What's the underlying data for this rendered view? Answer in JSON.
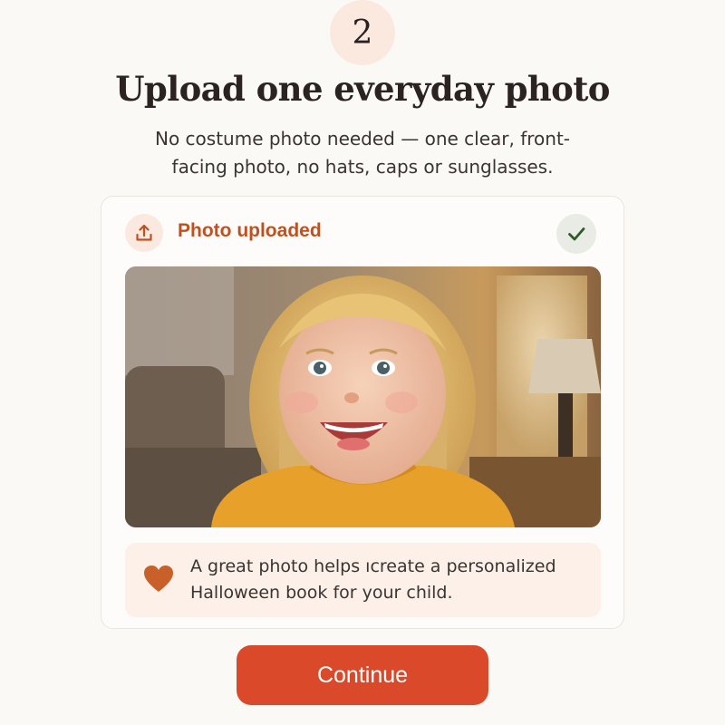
{
  "step": {
    "number": "2"
  },
  "header": {
    "title": "Upload one everyday photo",
    "subtitle": "No costume photo needed — one clear, front-facing photo, no hats, caps or sunglasses."
  },
  "upload_card": {
    "status_label": "Photo uploaded",
    "status_icon": "upload-icon",
    "complete_icon": "check-icon",
    "tip": {
      "icon": "heart-icon",
      "text": "A great photo helps ıcreate a personalized Halloween book for your child."
    }
  },
  "actions": {
    "continue_label": "Continue"
  },
  "colors": {
    "accent": "#d9492a",
    "accent_text": "#c2501f",
    "badge_bg": "#fbe9df",
    "check": "#2f5a2a",
    "page_bg": "#fbf9f6"
  }
}
